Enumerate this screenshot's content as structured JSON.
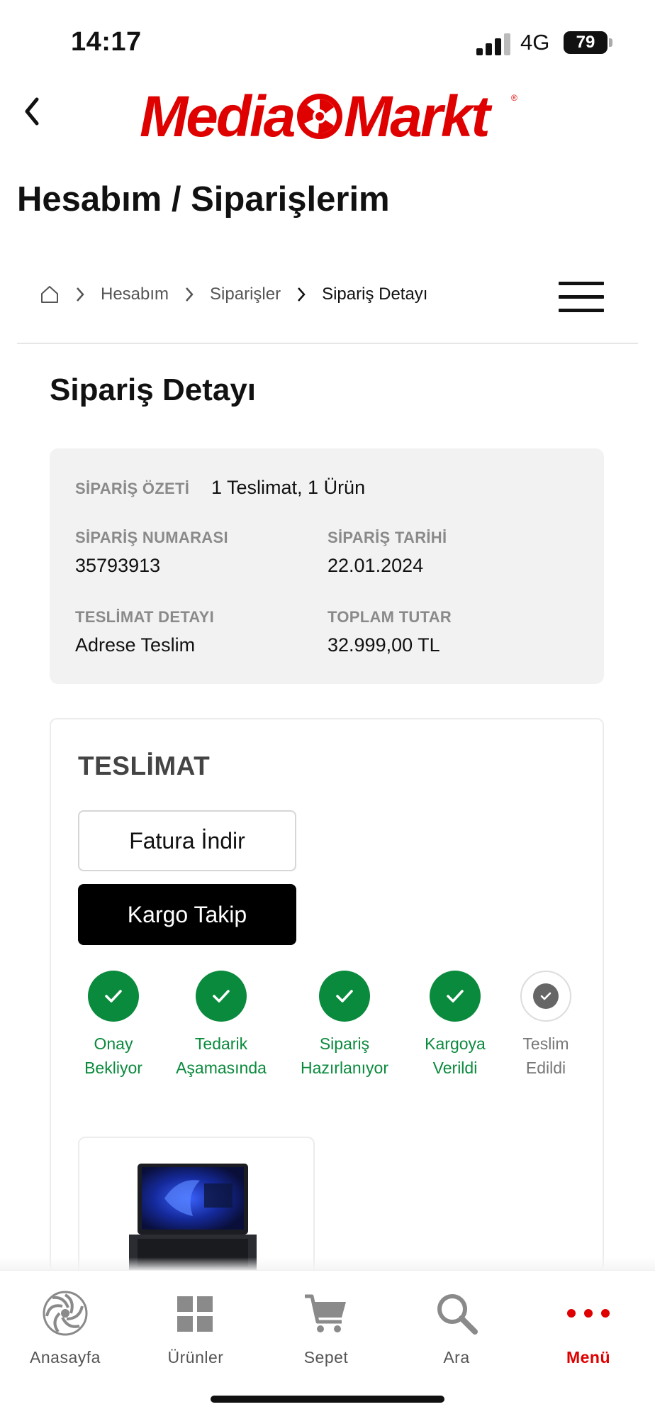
{
  "status_bar": {
    "time": "14:17",
    "network": "4G",
    "battery": "79"
  },
  "header": {
    "back_icon": "chevron-left-icon",
    "logo_text": "MediaMarkt",
    "brand_color": "#df0000"
  },
  "page": {
    "title": "Hesabım / Siparişlerim"
  },
  "breadcrumb": {
    "items": [
      "Hesabım",
      "Siparişler",
      "Sipariş Detayı"
    ]
  },
  "section": {
    "title": "Sipariş Detayı"
  },
  "summary": {
    "overview_label": "SİPARİŞ ÖZETİ",
    "overview_value": "1 Teslimat, 1 Ürün",
    "order_number_label": "SİPARİŞ NUMARASI",
    "order_number": "35793913",
    "order_date_label": "SİPARİŞ TARİHİ",
    "order_date": "22.01.2024",
    "delivery_label": "TESLİMAT DETAYI",
    "delivery_value": "Adrese Teslim",
    "total_label": "TOPLAM TUTAR",
    "total_value": "32.999,00 TL"
  },
  "delivery": {
    "title": "TESLİMAT",
    "invoice_button": "Fatura İndir",
    "tracking_button": "Kargo Takip",
    "steps": [
      {
        "line1": "Onay",
        "line2": "Bekliyor",
        "status": "done"
      },
      {
        "line1": "Tedarik",
        "line2": "Aşamasında",
        "status": "done"
      },
      {
        "line1": "Sipariş",
        "line2": "Hazırlanıyor",
        "status": "done"
      },
      {
        "line1": "Kargoya",
        "line2": "Verildi",
        "status": "done"
      },
      {
        "line1": "Teslim",
        "line2": "Edildi",
        "status": "pending"
      }
    ],
    "status_color_done": "#0a8a3c"
  },
  "bottom_nav": {
    "items": [
      {
        "label": "Anasayfa",
        "icon": "mediamarkt-spiral-icon"
      },
      {
        "label": "Ürünler",
        "icon": "grid-icon"
      },
      {
        "label": "Sepet",
        "icon": "cart-icon"
      },
      {
        "label": "Ara",
        "icon": "search-icon"
      },
      {
        "label": "Menü",
        "icon": "more-dots-icon",
        "active": true
      }
    ]
  }
}
